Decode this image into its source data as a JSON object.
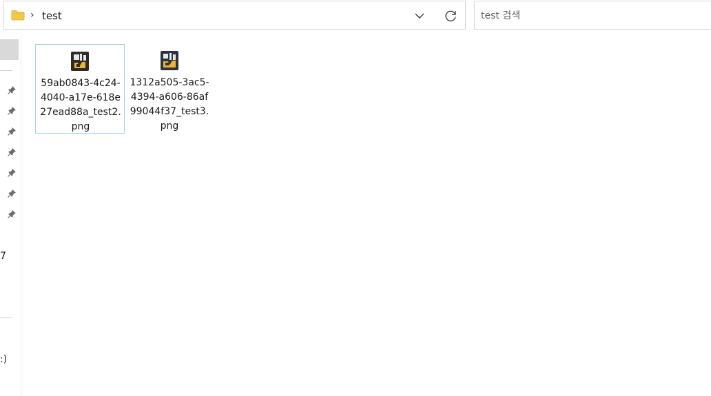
{
  "address": {
    "crumbs": [
      "test"
    ],
    "folder_icon": "folder-icon",
    "separator_icon": "chevron-right-icon",
    "dropdown_icon": "chevron-down-icon",
    "refresh_icon": "refresh-icon"
  },
  "search": {
    "placeholder": "test 검색"
  },
  "nav": {
    "pins": [
      "pin-icon",
      "pin-icon",
      "pin-icon",
      "pin-icon",
      "pin-icon",
      "pin-icon",
      "pin-icon"
    ],
    "truncated_item_1": "7",
    "truncated_item_2": ":)"
  },
  "files": [
    {
      "name": "59ab0843-4c24-4040-a17e-618e27ead88a_test2.png",
      "selected": true,
      "icon": "image-file-icon"
    },
    {
      "name": "1312a505-3ac5-4394-a606-86af99044f37_test3.png",
      "selected": false,
      "icon": "image-file-icon"
    }
  ],
  "colors": {
    "selection_border": "#99d1ff",
    "folder_yellow": "#f3c948",
    "nav_selected": "#d9d9d9"
  }
}
